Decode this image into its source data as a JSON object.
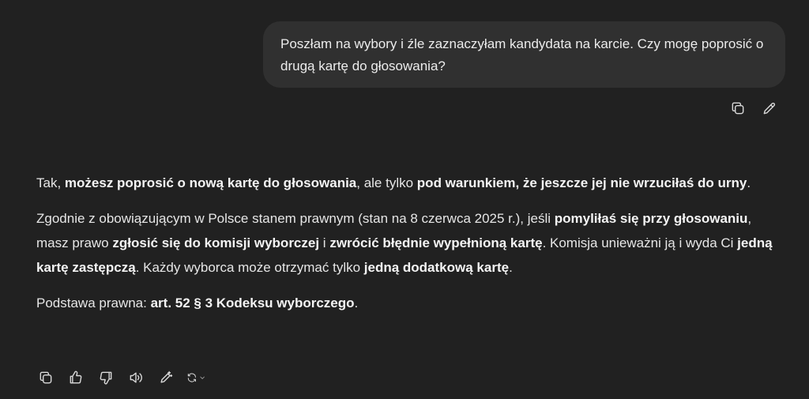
{
  "user_message": {
    "text": "Poszłam na wybory i źle zaznaczyłam kandydata na karcie. Czy mogę poprosić o drugą kartę do głosowania?"
  },
  "user_actions": [
    {
      "icon": "copy-icon"
    },
    {
      "icon": "edit-icon"
    }
  ],
  "assistant_message": {
    "p1": {
      "t1": "Tak, ",
      "b1": "możesz poprosić o nową kartę do głosowania",
      "t2": ", ale tylko ",
      "b2": "pod warunkiem, że jeszcze jej nie wrzuciłaś do urny",
      "t3": "."
    },
    "p2": {
      "t1": "Zgodnie z obowiązującym w Polsce stanem prawnym (stan na 8 czerwca 2025 r.), jeśli ",
      "b1": "pomyliłaś się przy głosowaniu",
      "t2": ", masz prawo ",
      "b2": "zgłosić się do komisji wyborczej",
      "t3": " i ",
      "b3": "zwrócić błędnie wypełnioną kartę",
      "t4": ". Komisja unieważni ją i wyda Ci ",
      "b4": "jedną kartę zastępczą",
      "t5": ". Każdy wyborca może otrzymać tylko ",
      "b5": "jedną dodatkową kartę",
      "t6": "."
    },
    "p3": {
      "t1": "Podstawa prawna: ",
      "b1": "art. 52 § 3 Kodeksu wyborczego",
      "t2": "."
    }
  },
  "assistant_actions": [
    {
      "icon": "copy-icon"
    },
    {
      "icon": "thumbs-up-icon"
    },
    {
      "icon": "thumbs-down-icon"
    },
    {
      "icon": "read-aloud-icon"
    },
    {
      "icon": "edit-in-canvas-icon"
    },
    {
      "icon": "regenerate-icon"
    }
  ]
}
